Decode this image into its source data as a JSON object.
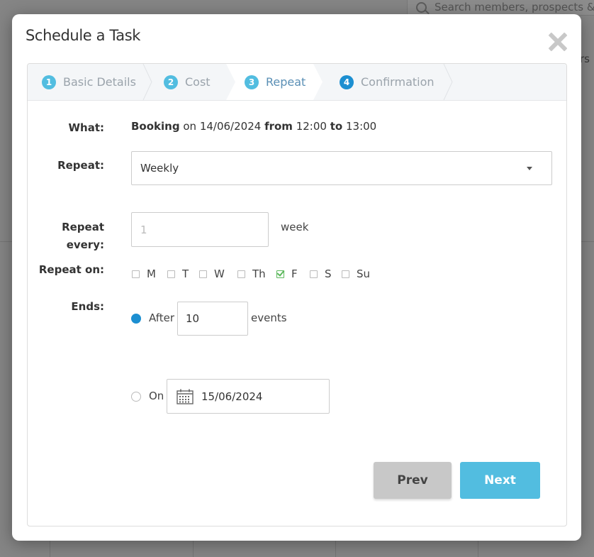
{
  "background": {
    "search_placeholder": "Search members, prospects & s",
    "side_text": "rs"
  },
  "modal": {
    "title": "Schedule a Task",
    "close_icon": "close-icon"
  },
  "steps": [
    {
      "number": "1",
      "label": "Basic Details",
      "state": "inactive"
    },
    {
      "number": "2",
      "label": "Cost",
      "state": "inactive"
    },
    {
      "number": "3",
      "label": "Repeat",
      "state": "active"
    },
    {
      "number": "4",
      "label": "Confirmation",
      "state": "upcoming"
    }
  ],
  "form": {
    "what": {
      "label": "What:",
      "type": "Booking",
      "on_word": "on",
      "date": "14/06/2024",
      "from_word": "from",
      "start": "12:00",
      "to_word": "to",
      "end": "13:00"
    },
    "repeat": {
      "label": "Repeat:",
      "value": "Weekly"
    },
    "repeat_every": {
      "label_line1": "Repeat",
      "label_line2": "every:",
      "placeholder": "1",
      "value": "",
      "unit": "week"
    },
    "repeat_on": {
      "label": "Repeat on:",
      "days": [
        {
          "label": "M",
          "checked": false
        },
        {
          "label": "T",
          "checked": false
        },
        {
          "label": "W",
          "checked": false
        },
        {
          "label": "Th",
          "checked": false
        },
        {
          "label": "F",
          "checked": true
        },
        {
          "label": "S",
          "checked": false
        },
        {
          "label": "Su",
          "checked": false
        }
      ]
    },
    "ends": {
      "label": "Ends:",
      "after_label": "After",
      "after_value": "10",
      "after_unit": "events",
      "after_selected": true,
      "on_label": "On",
      "on_date": "15/06/2024",
      "on_selected": false
    }
  },
  "buttons": {
    "prev": "Prev",
    "next": "Next"
  },
  "colors": {
    "accent": "#52bde0",
    "radio_selected": "#1c8fd1",
    "check": "#5cb85c"
  }
}
